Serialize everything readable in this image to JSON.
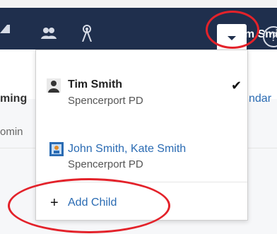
{
  "navbar": {
    "user_name": "Tim Smith",
    "icons": [
      "inbox-icon",
      "people-icon",
      "broadcast-icon",
      "chevron-down-icon",
      "help-icon"
    ]
  },
  "dropdown": {
    "items": [
      {
        "name": "Tim Smith",
        "school": "Spencerport PD",
        "selected": true
      },
      {
        "name": "John Smith, Kate Smith",
        "school": "Spencerport PD",
        "selected": false
      }
    ],
    "add_label": "Add Child"
  },
  "background": {
    "left_heading": "ming",
    "left_sub": "omin",
    "right_link": "ndar"
  },
  "colors": {
    "navbar": "#1f2f4d",
    "link": "#2a6bb3",
    "annotation": "#e3222a"
  }
}
